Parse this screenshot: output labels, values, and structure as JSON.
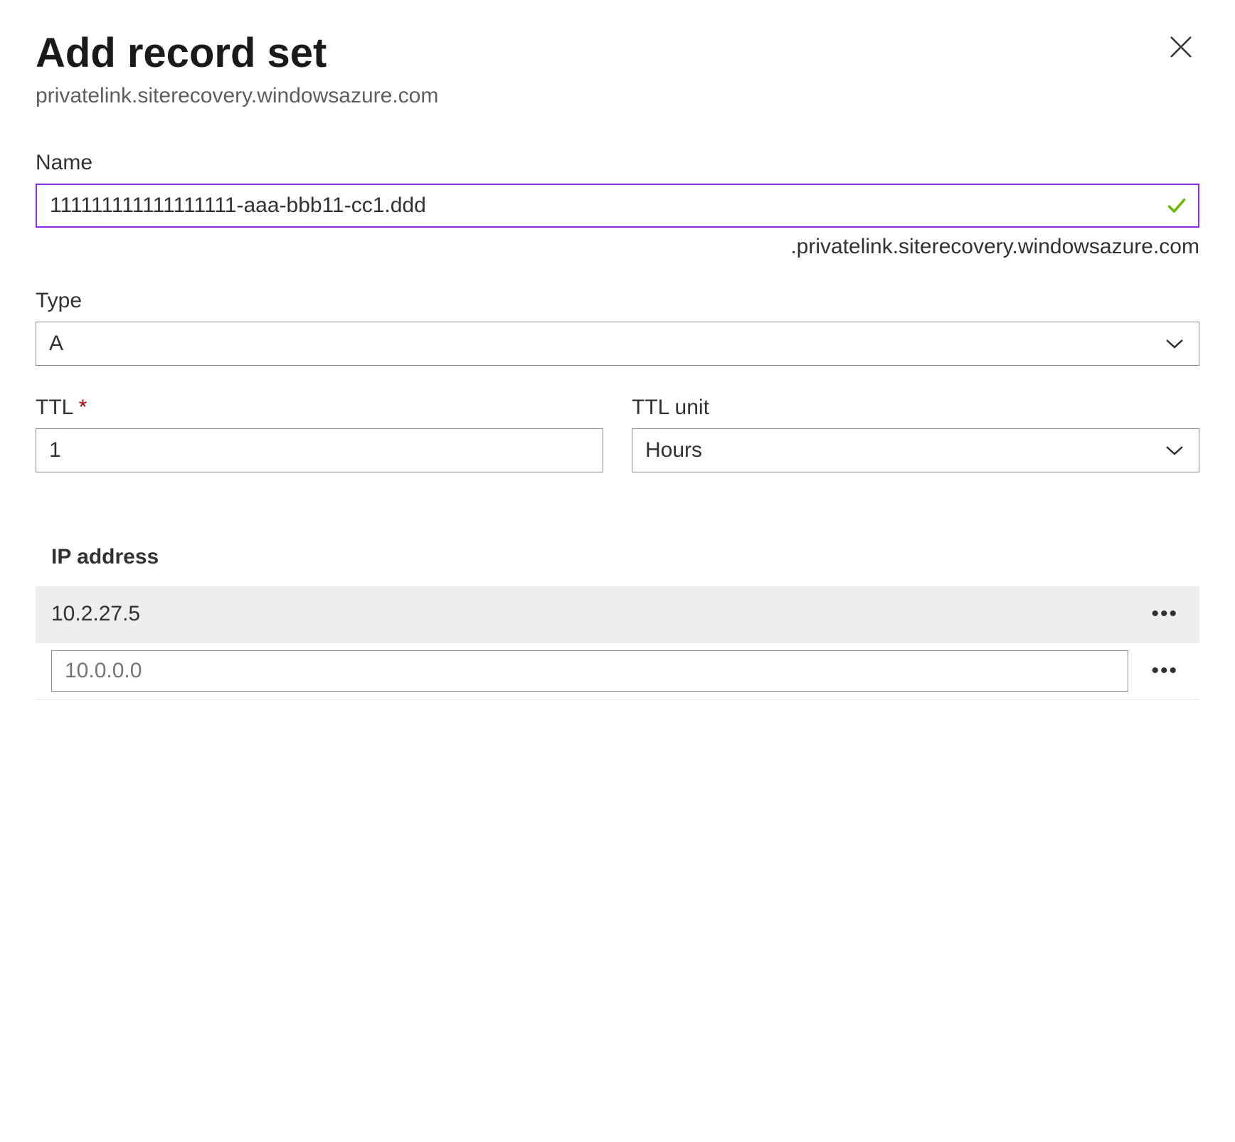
{
  "header": {
    "title": "Add record set",
    "subtitle": "privatelink.siterecovery.windowsazure.com"
  },
  "fields": {
    "name": {
      "label": "Name",
      "value": "111111111111111111-aaa-bbb11-cc1.ddd",
      "suffix": ".privatelink.siterecovery.windowsazure.com"
    },
    "type": {
      "label": "Type",
      "value": "A"
    },
    "ttl": {
      "label": "TTL",
      "value": "1"
    },
    "ttl_unit": {
      "label": "TTL unit",
      "value": "Hours"
    }
  },
  "ip_section": {
    "label": "IP address",
    "rows": [
      {
        "value": "10.2.27.5"
      }
    ],
    "new_placeholder": "10.0.0.0"
  }
}
